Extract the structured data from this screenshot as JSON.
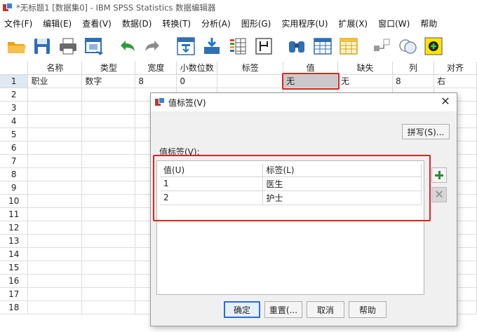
{
  "window": {
    "title": "*无标题1 [数据集0] - IBM SPSS Statistics 数据编辑器"
  },
  "menu": [
    "文件(F)",
    "编辑(E)",
    "查看(V)",
    "数据(D)",
    "转换(T)",
    "分析(A)",
    "图形(G)",
    "实用程序(U)",
    "扩展(X)",
    "窗口(W)",
    "帮助"
  ],
  "toolbar": [
    "open-folder-icon",
    "save-icon",
    "print-icon",
    "dialog-recall-icon",
    "undo-icon",
    "redo-icon",
    "goto-case-icon",
    "goto-variable-icon",
    "variables-icon",
    "run-descriptive-icon",
    "find-icon",
    "insert-cases-icon",
    "insert-variable-icon",
    "split-file-icon",
    "weight-cases-icon",
    "select-cases-icon",
    "value-labels-icon",
    "use-sets-icon"
  ],
  "grid": {
    "columns": [
      "名称",
      "类型",
      "宽度",
      "小数位数",
      "标签",
      "值",
      "缺失",
      "列",
      "对齐"
    ],
    "rows": [
      {
        "num": "1",
        "cells": [
          "职业",
          "数字",
          "8",
          "0",
          "",
          "无",
          "无",
          "8",
          "右"
        ]
      },
      {
        "num": "2",
        "cells": [
          "",
          "",
          "",
          "",
          "",
          "",
          "",
          "",
          ""
        ]
      },
      {
        "num": "3",
        "cells": [
          "",
          "",
          "",
          "",
          "",
          "",
          "",
          "",
          ""
        ]
      },
      {
        "num": "4",
        "cells": [
          "",
          "",
          "",
          "",
          "",
          "",
          "",
          "",
          ""
        ]
      },
      {
        "num": "5",
        "cells": [
          "",
          "",
          "",
          "",
          "",
          "",
          "",
          "",
          ""
        ]
      },
      {
        "num": "6",
        "cells": [
          "",
          "",
          "",
          "",
          "",
          "",
          "",
          "",
          ""
        ]
      },
      {
        "num": "7",
        "cells": [
          "",
          "",
          "",
          "",
          "",
          "",
          "",
          "",
          ""
        ]
      },
      {
        "num": "8",
        "cells": [
          "",
          "",
          "",
          "",
          "",
          "",
          "",
          "",
          ""
        ]
      },
      {
        "num": "9",
        "cells": [
          "",
          "",
          "",
          "",
          "",
          "",
          "",
          "",
          ""
        ]
      },
      {
        "num": "10",
        "cells": [
          "",
          "",
          "",
          "",
          "",
          "",
          "",
          "",
          ""
        ]
      },
      {
        "num": "11",
        "cells": [
          "",
          "",
          "",
          "",
          "",
          "",
          "",
          "",
          ""
        ]
      },
      {
        "num": "12",
        "cells": [
          "",
          "",
          "",
          "",
          "",
          "",
          "",
          "",
          ""
        ]
      },
      {
        "num": "13",
        "cells": [
          "",
          "",
          "",
          "",
          "",
          "",
          "",
          "",
          ""
        ]
      },
      {
        "num": "14",
        "cells": [
          "",
          "",
          "",
          "",
          "",
          "",
          "",
          "",
          ""
        ]
      },
      {
        "num": "15",
        "cells": [
          "",
          "",
          "",
          "",
          "",
          "",
          "",
          "",
          ""
        ]
      },
      {
        "num": "16",
        "cells": [
          "",
          "",
          "",
          "",
          "",
          "",
          "",
          "",
          ""
        ]
      },
      {
        "num": "17",
        "cells": [
          "",
          "",
          "",
          "",
          "",
          "",
          "",
          "",
          ""
        ]
      },
      {
        "num": "18",
        "cells": [
          "",
          "",
          "",
          "",
          "",
          "",
          "",
          "",
          ""
        ]
      }
    ]
  },
  "dialog": {
    "title": "值标签(V)",
    "spell_label": "拼写(S)...",
    "list_label": "值标签(V):",
    "col_value": "值(U)",
    "col_label": "标签(L)",
    "items": [
      {
        "value": "1",
        "label": "医生"
      },
      {
        "value": "2",
        "label": "护士"
      }
    ],
    "add_icon": "plus-icon",
    "delete_icon": "delete-x-icon",
    "ok_label": "确定",
    "reset_label": "重置(...",
    "cancel_label": "取消",
    "help_label": "帮助"
  },
  "colors": {
    "highlight": "#e0221c",
    "ok_border": "#2b6cd6",
    "add_green": "#2e8b2e"
  }
}
